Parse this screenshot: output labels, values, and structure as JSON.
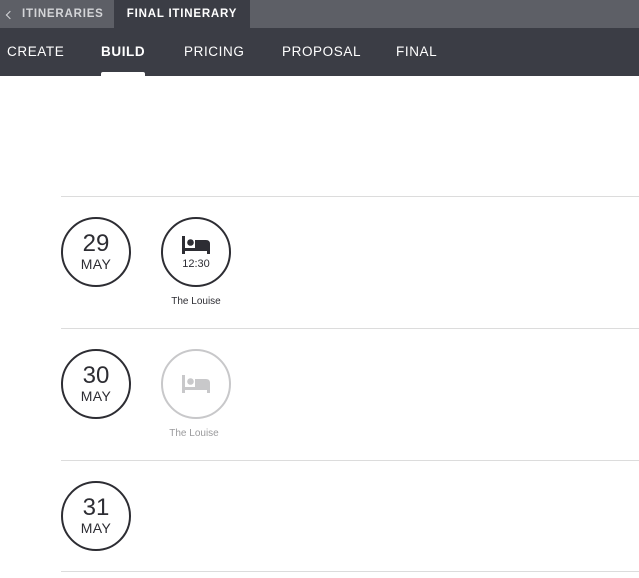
{
  "breadcrumb": {
    "back_label": "ITINERARIES",
    "current_label": "FINAL ITINERARY"
  },
  "steps": [
    {
      "label": "CREATE",
      "active": false
    },
    {
      "label": "BUILD",
      "active": true
    },
    {
      "label": "PRICING",
      "active": false
    },
    {
      "label": "PROPOSAL",
      "active": false
    },
    {
      "label": "FINAL",
      "active": false
    }
  ],
  "days": [
    {
      "day": "29",
      "month": "MAY",
      "stay": {
        "icon": "bed-icon",
        "time": "12:30",
        "name": "The Louise",
        "faded": false
      }
    },
    {
      "day": "30",
      "month": "MAY",
      "stay": {
        "icon": "bed-icon",
        "time": "",
        "name": "The Louise",
        "faded": true
      }
    },
    {
      "day": "31",
      "month": "MAY",
      "stay": null
    }
  ],
  "colors": {
    "topbar": "#5d5f66",
    "stepbar": "#3b3d45",
    "circle_dark": "#2d2d33",
    "circle_faded": "#c8c8ca"
  }
}
